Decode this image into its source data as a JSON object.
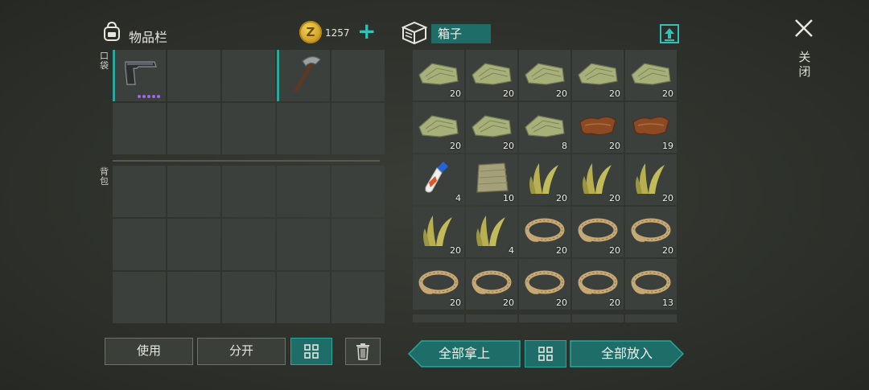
{
  "inventory": {
    "title": "物品栏",
    "icon": "backpack-icon",
    "currency": {
      "icon": "coin-icon",
      "coin_symbol": "Z",
      "amount": "1257",
      "add_icon": "plus-icon"
    },
    "pocket_label": "口袋",
    "backpack_label": "背包",
    "pocket_slots": [
      {
        "item": "pistol-icon",
        "dots": 5
      },
      {
        "item": ""
      },
      {
        "item": ""
      },
      {
        "item": "hatchet-icon"
      },
      {
        "item": ""
      }
    ],
    "pocket_rows": 2,
    "backpack_rows": 3,
    "buttons": {
      "use": "使用",
      "split": "分开",
      "sort_icon": "sort-grid-icon",
      "trash_icon": "trash-icon"
    }
  },
  "chest": {
    "name": "箱子",
    "icon": "box-icon",
    "upload_icon": "upload-icon",
    "items": [
      {
        "item": "cloth",
        "count": "20"
      },
      {
        "item": "cloth",
        "count": "20"
      },
      {
        "item": "cloth",
        "count": "20"
      },
      {
        "item": "cloth",
        "count": "20"
      },
      {
        "item": "cloth",
        "count": "20"
      },
      {
        "item": "cloth",
        "count": "20"
      },
      {
        "item": "cloth",
        "count": "20"
      },
      {
        "item": "cloth",
        "count": "8"
      },
      {
        "item": "leather",
        "count": "20"
      },
      {
        "item": "leather",
        "count": "19"
      },
      {
        "item": "glue",
        "count": "4"
      },
      {
        "item": "burlap",
        "count": "10"
      },
      {
        "item": "fiber",
        "count": "20"
      },
      {
        "item": "fiber",
        "count": "20"
      },
      {
        "item": "fiber",
        "count": "20"
      },
      {
        "item": "fiber",
        "count": "20"
      },
      {
        "item": "fiber",
        "count": "4"
      },
      {
        "item": "rope",
        "count": "20"
      },
      {
        "item": "rope",
        "count": "20"
      },
      {
        "item": "rope",
        "count": "20"
      },
      {
        "item": "rope",
        "count": "20"
      },
      {
        "item": "rope",
        "count": "20"
      },
      {
        "item": "rope",
        "count": "20"
      },
      {
        "item": "rope",
        "count": "20"
      },
      {
        "item": "rope",
        "count": "13"
      }
    ],
    "buttons": {
      "take_all": "全部拿上",
      "put_all": "全部放入",
      "sort_icon": "sort-grid-icon"
    }
  },
  "close": {
    "icon": "close-icon",
    "label": "关闭"
  },
  "colors": {
    "accent": "#2aa69b",
    "accent_fill": "#1e6d69",
    "slot": "#3b403c",
    "coin": "#e8b830"
  }
}
